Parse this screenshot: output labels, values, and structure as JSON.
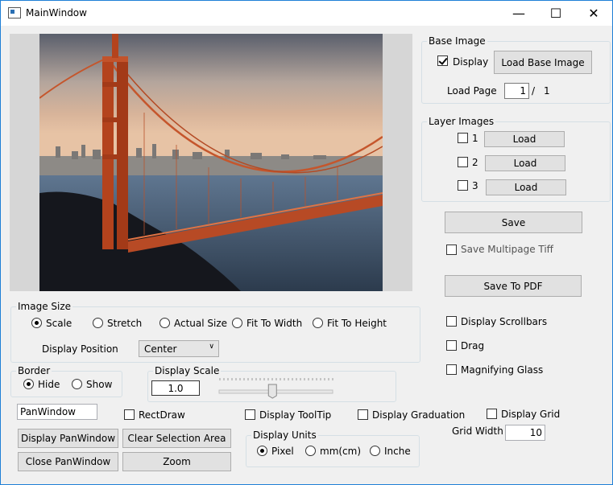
{
  "window": {
    "title": "MainWindow",
    "minimize": "—",
    "maximize": "☐",
    "close": "✕",
    "icon": "app-window-icon"
  },
  "base_image": {
    "title": "Base Image",
    "display_label": "Display",
    "display_checked": true,
    "load_button": "Load Base Image",
    "load_page_label": "Load Page",
    "page_value": "1",
    "page_sep": "/",
    "page_total": "1"
  },
  "layer_images": {
    "title": "Layer Images",
    "layers": [
      {
        "num": "1",
        "load": "Load"
      },
      {
        "num": "2",
        "load": "Load"
      },
      {
        "num": "3",
        "load": "Load"
      }
    ]
  },
  "save_button": "Save",
  "save_multipage_label": "Save Multipage Tiff",
  "save_pdf_button": "Save To PDF",
  "options": {
    "display_scrollbars": "Display Scrollbars",
    "drag": "Drag",
    "magnifying_glass": "Magnifying Glass"
  },
  "image_size": {
    "title": "Image Size",
    "options": [
      "Scale",
      "Stretch",
      "Actual Size",
      "Fit To Width",
      "Fit To Height"
    ],
    "selected": "Scale",
    "display_position_label": "Display Position",
    "display_position_value": "Center"
  },
  "border": {
    "title": "Border",
    "options": [
      "Hide",
      "Show"
    ],
    "selected": "Hide"
  },
  "display_scale": {
    "title": "Display Scale",
    "value": "1.0",
    "slider_fraction": 0.47
  },
  "pan_window": {
    "name_value": "PanWindow",
    "display_button": "Display PanWindow",
    "close_button": "Close PanWindow"
  },
  "rect_draw_label": "RectDraw",
  "clear_selection_button": "Clear Selection Area",
  "zoom_button": "Zoom",
  "display_tooltip_label": "Display ToolTip",
  "display_graduation_label": "Display Graduation",
  "display_grid_label": "Display Grid",
  "grid_width": {
    "label": "Grid Width",
    "value": "10"
  },
  "display_units": {
    "title": "Display Units",
    "options": [
      "Pixel",
      "mm(cm)",
      "Inches"
    ],
    "selected": "Pixel"
  }
}
